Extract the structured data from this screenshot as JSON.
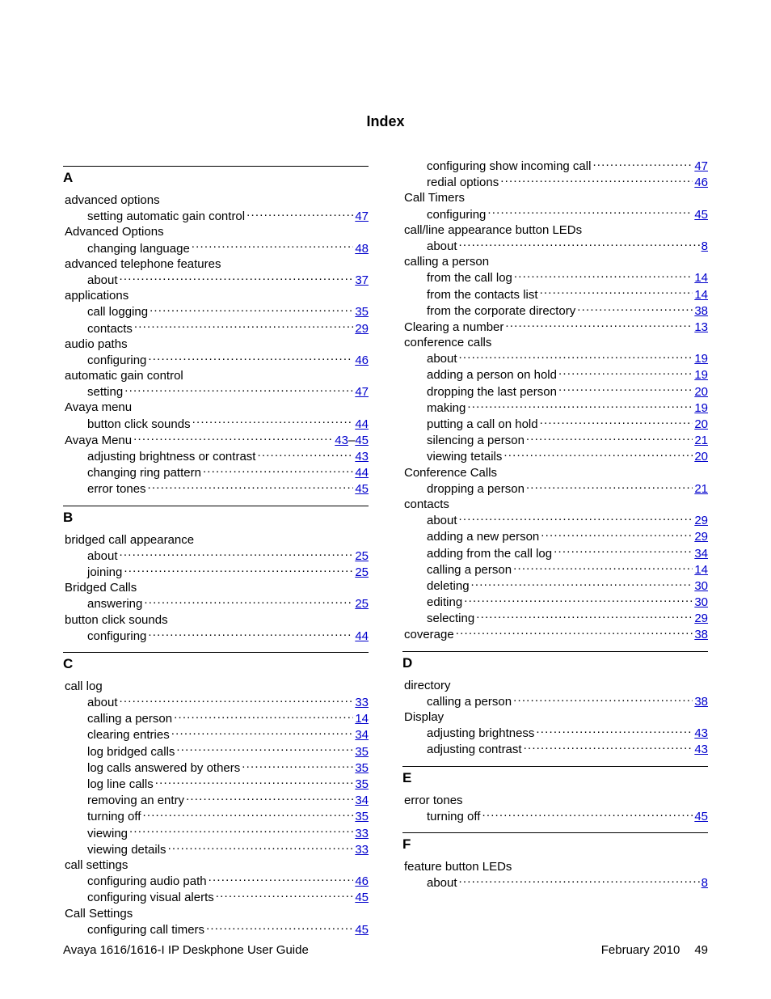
{
  "title": "Index",
  "footer": {
    "left": "Avaya 1616/1616-I IP Deskphone User Guide",
    "date": "February 2010",
    "page": "49"
  },
  "columns": [
    {
      "groups": [
        {
          "letter": "A",
          "entries": [
            {
              "level": 0,
              "term": "advanced options"
            },
            {
              "level": 1,
              "term": "setting automatic gain control",
              "pages": [
                "47"
              ]
            },
            {
              "level": 0,
              "term": "Advanced Options"
            },
            {
              "level": 1,
              "term": "changing language",
              "pages": [
                "48"
              ]
            },
            {
              "level": 0,
              "term": "advanced telephone features"
            },
            {
              "level": 1,
              "term": "about",
              "pages": [
                "37"
              ]
            },
            {
              "level": 0,
              "term": "applications"
            },
            {
              "level": 1,
              "term": "call logging",
              "pages": [
                "35"
              ]
            },
            {
              "level": 1,
              "term": "contacts",
              "pages": [
                "29"
              ]
            },
            {
              "level": 0,
              "term": "audio paths"
            },
            {
              "level": 1,
              "term": "configuring",
              "pages": [
                "46"
              ]
            },
            {
              "level": 0,
              "term": "automatic gain control"
            },
            {
              "level": 1,
              "term": "setting",
              "pages": [
                "47"
              ]
            },
            {
              "level": 0,
              "term": "Avaya menu"
            },
            {
              "level": 1,
              "term": "button click sounds",
              "pages": [
                "44"
              ]
            },
            {
              "level": 0,
              "term": "Avaya Menu",
              "pages": [
                "43",
                "45"
              ]
            },
            {
              "level": 1,
              "term": "adjusting brightness or contrast",
              "pages": [
                "43"
              ]
            },
            {
              "level": 1,
              "term": "changing ring pattern",
              "pages": [
                "44"
              ]
            },
            {
              "level": 1,
              "term": "error tones",
              "pages": [
                "45"
              ]
            }
          ]
        },
        {
          "letter": "B",
          "entries": [
            {
              "level": 0,
              "term": "bridged call appearance"
            },
            {
              "level": 1,
              "term": "about",
              "pages": [
                "25"
              ]
            },
            {
              "level": 1,
              "term": "joining",
              "pages": [
                "25"
              ]
            },
            {
              "level": 0,
              "term": "Bridged Calls"
            },
            {
              "level": 1,
              "term": "answering",
              "pages": [
                "25"
              ]
            },
            {
              "level": 0,
              "term": "button click sounds"
            },
            {
              "level": 1,
              "term": "configuring",
              "pages": [
                "44"
              ]
            }
          ]
        },
        {
          "letter": "C",
          "entries": [
            {
              "level": 0,
              "term": "call log"
            },
            {
              "level": 1,
              "term": "about",
              "pages": [
                "33"
              ]
            },
            {
              "level": 1,
              "term": "calling a person",
              "pages": [
                "14"
              ]
            },
            {
              "level": 1,
              "term": "clearing entries",
              "pages": [
                "34"
              ]
            },
            {
              "level": 1,
              "term": "log bridged calls",
              "pages": [
                "35"
              ]
            },
            {
              "level": 1,
              "term": "log calls answered by others",
              "pages": [
                "35"
              ]
            },
            {
              "level": 1,
              "term": "log line calls",
              "pages": [
                "35"
              ]
            },
            {
              "level": 1,
              "term": "removing an entry",
              "pages": [
                "34"
              ]
            },
            {
              "level": 1,
              "term": "turning off",
              "pages": [
                "35"
              ]
            },
            {
              "level": 1,
              "term": "viewing",
              "pages": [
                "33"
              ]
            },
            {
              "level": 1,
              "term": "viewing details",
              "pages": [
                "33"
              ]
            },
            {
              "level": 0,
              "term": "call settings"
            },
            {
              "level": 1,
              "term": "configuring audio path",
              "pages": [
                "46"
              ]
            },
            {
              "level": 1,
              "term": "configuring visual alerts",
              "pages": [
                "45"
              ]
            },
            {
              "level": 0,
              "term": "Call Settings"
            },
            {
              "level": 1,
              "term": "configuring call timers",
              "pages": [
                "45"
              ]
            }
          ]
        }
      ]
    },
    {
      "groups": [
        {
          "entries": [
            {
              "level": 1,
              "term": "configuring show incoming call",
              "pages": [
                "47"
              ]
            },
            {
              "level": 1,
              "term": "redial options",
              "pages": [
                "46"
              ]
            },
            {
              "level": 0,
              "term": "Call Timers"
            },
            {
              "level": 1,
              "term": "configuring",
              "pages": [
                "45"
              ]
            },
            {
              "level": 0,
              "term": "call/line appearance button LEDs"
            },
            {
              "level": 1,
              "term": "about",
              "pages": [
                "8"
              ]
            },
            {
              "level": 0,
              "term": "calling a person"
            },
            {
              "level": 1,
              "term": "from the call log",
              "pages": [
                "14"
              ]
            },
            {
              "level": 1,
              "term": "from the contacts list",
              "pages": [
                "14"
              ]
            },
            {
              "level": 1,
              "term": "from the corporate directory",
              "pages": [
                "38"
              ]
            },
            {
              "level": 0,
              "term": "Clearing a number",
              "pages": [
                "13"
              ]
            },
            {
              "level": 0,
              "term": "conference calls"
            },
            {
              "level": 1,
              "term": "about",
              "pages": [
                "19"
              ]
            },
            {
              "level": 1,
              "term": "adding a person on hold",
              "pages": [
                "19"
              ]
            },
            {
              "level": 1,
              "term": "dropping the last person",
              "pages": [
                "20"
              ]
            },
            {
              "level": 1,
              "term": "making",
              "pages": [
                "19"
              ]
            },
            {
              "level": 1,
              "term": "putting a call on hold",
              "pages": [
                "20"
              ]
            },
            {
              "level": 1,
              "term": "silencing a person",
              "pages": [
                "21"
              ]
            },
            {
              "level": 1,
              "term": "viewing tetails",
              "pages": [
                "20"
              ]
            },
            {
              "level": 0,
              "term": "Conference Calls"
            },
            {
              "level": 1,
              "term": "dropping a person",
              "pages": [
                "21"
              ]
            },
            {
              "level": 0,
              "term": "contacts"
            },
            {
              "level": 1,
              "term": "about",
              "pages": [
                "29"
              ]
            },
            {
              "level": 1,
              "term": "adding a new person",
              "pages": [
                "29"
              ]
            },
            {
              "level": 1,
              "term": "adding from the call log",
              "pages": [
                "34"
              ]
            },
            {
              "level": 1,
              "term": "calling a person",
              "pages": [
                "14"
              ]
            },
            {
              "level": 1,
              "term": "deleting",
              "pages": [
                "30"
              ]
            },
            {
              "level": 1,
              "term": "editing",
              "pages": [
                "30"
              ]
            },
            {
              "level": 1,
              "term": "selecting",
              "pages": [
                "29"
              ]
            },
            {
              "level": 0,
              "term": "coverage",
              "pages": [
                "38"
              ]
            }
          ]
        },
        {
          "letter": "D",
          "entries": [
            {
              "level": 0,
              "term": "directory"
            },
            {
              "level": 1,
              "term": "calling a person",
              "pages": [
                "38"
              ]
            },
            {
              "level": 0,
              "term": "Display"
            },
            {
              "level": 1,
              "term": "adjusting brightness",
              "pages": [
                "43"
              ]
            },
            {
              "level": 1,
              "term": "adjusting contrast",
              "pages": [
                "43"
              ]
            }
          ]
        },
        {
          "letter": "E",
          "entries": [
            {
              "level": 0,
              "term": "error tones"
            },
            {
              "level": 1,
              "term": "turning off",
              "pages": [
                "45"
              ]
            }
          ]
        },
        {
          "letter": "F",
          "entries": [
            {
              "level": 0,
              "term": "feature button LEDs"
            },
            {
              "level": 1,
              "term": "about",
              "pages": [
                "8"
              ]
            }
          ]
        }
      ]
    }
  ]
}
